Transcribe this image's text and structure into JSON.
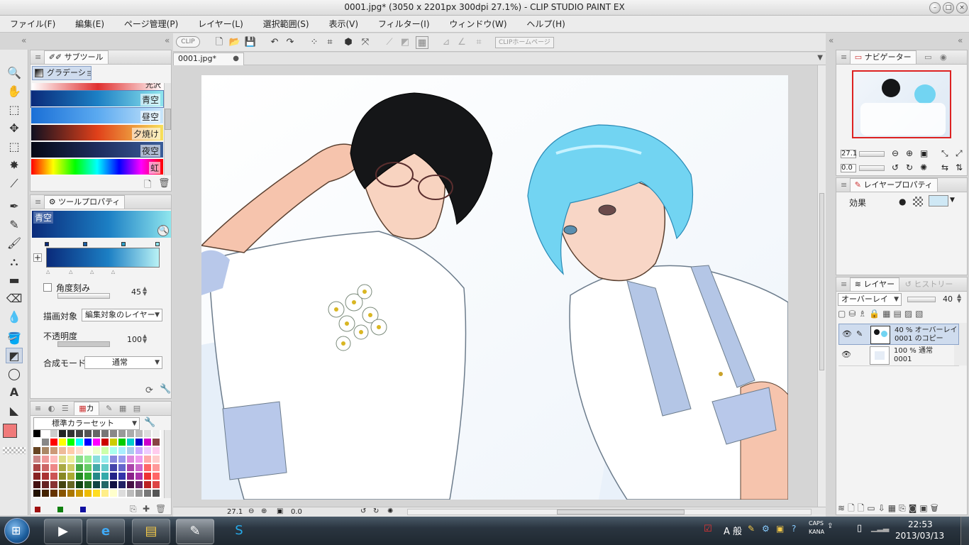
{
  "window": {
    "title": "0001.jpg* (3050 x 2201px 300dpi 27.1%)  - CLIP STUDIO PAINT EX"
  },
  "menu": [
    "ファイル(F)",
    "編集(E)",
    "ページ管理(P)",
    "レイヤー(L)",
    "選択範囲(S)",
    "表示(V)",
    "フィルター(I)",
    "ウィンドウ(W)",
    "ヘルプ(H)"
  ],
  "toolbar": {
    "clip_logo": "CLIP",
    "home_button": "CLIPホームページ"
  },
  "document_tab": {
    "label": "0001.jpg*"
  },
  "subtool": {
    "tab": "サブツール",
    "current": "グラデーション",
    "partial_top": "光沢",
    "gradients": [
      {
        "label": "青空",
        "colors": [
          "#0a2a7a",
          "#1c7fc4",
          "#8fe6ee"
        ],
        "selected": true
      },
      {
        "label": "昼空",
        "colors": [
          "#1a6fd6",
          "#5aa9f0",
          "#c9e6fb"
        ]
      },
      {
        "label": "夕焼け",
        "colors": [
          "#101020",
          "#e0401a",
          "#f7e15a"
        ]
      },
      {
        "label": "夜空",
        "colors": [
          "#050814",
          "#1e2d5e",
          "#3a5d9a"
        ]
      },
      {
        "label": "虹",
        "colors": [
          "#ff0000",
          "#ffff00",
          "#00ff00",
          "#00ffff",
          "#0000ff",
          "#ff00ff",
          "#ff0000"
        ]
      }
    ]
  },
  "tool_property": {
    "tab": "ツールプロパティ",
    "preset_name": "青空",
    "angle_step_label": "角度刻み",
    "angle_step_value": "45",
    "draw_target_label": "描画対象",
    "draw_target_value": "編集対象のレイヤー",
    "opacity_label": "不透明度",
    "opacity_value": "100",
    "blend_label": "合成モード",
    "blend_value": "通常"
  },
  "color_set": {
    "tab": "カ",
    "set_name": "標準カラーセット"
  },
  "navigator": {
    "tab": "ナビゲーター",
    "zoom_value": "27.1",
    "rotate_value": "0.0"
  },
  "layer_property": {
    "tab": "レイヤープロパティ",
    "effect_label": "効果"
  },
  "layers_panel": {
    "tab": "レイヤー",
    "history_tab": "ヒストリー",
    "blend_mode": "オーバーレイ",
    "opacity": "40",
    "layers": [
      {
        "line1": "40 % オーバーレイ",
        "line2": "0001 のコピー",
        "selected": true
      },
      {
        "line1": "100 % 通常",
        "line2": "0001",
        "selected": false
      }
    ]
  },
  "status": {
    "zoom": "27.1",
    "rotation": "0.0"
  },
  "taskbar": {
    "ime": "A 般",
    "caps": "CAPS",
    "kana": "KANA",
    "time": "22:53",
    "date": "2013/03/13"
  },
  "colors": {
    "main_color": "#f07a7a",
    "accent": "#3a78c4"
  }
}
